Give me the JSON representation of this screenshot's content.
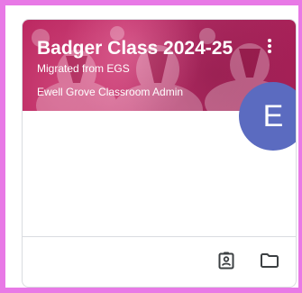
{
  "class_card": {
    "title": "Badger Class 2024-25",
    "section": "Migrated from EGS",
    "owner": "Ewell Grove Classroom Admin",
    "avatar_initial": "E",
    "more_icon": "more-vertical-icon",
    "footer_icons": [
      "assignment-ind-icon",
      "folder-icon"
    ]
  },
  "colors": {
    "banner": "#b8235d",
    "avatar": "#5b6bc0",
    "frame_highlight": "#e879e6",
    "icon": "#3c4043"
  }
}
